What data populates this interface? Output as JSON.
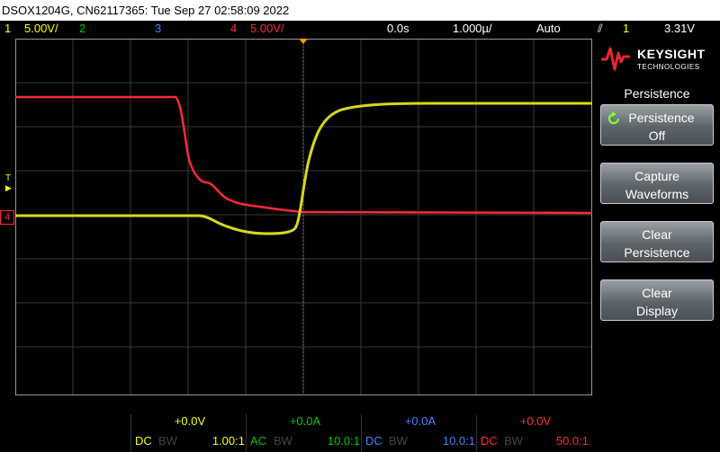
{
  "title_bar": {
    "text": "DSOX1204G, CN62117365: Tue Sep 27 02:58:09 2022"
  },
  "status_bar": {
    "ch1_num": "1",
    "ch1_scale": "5.00V/",
    "ch2_num": "2",
    "ch3_num": "3",
    "ch4_num": "4",
    "ch4_scale": "5.00V/",
    "delay": "0.0s",
    "timebase": "1.000µ/",
    "trigger_mode": "Auto",
    "trigger_source": "1",
    "trigger_level": "3.31V"
  },
  "colors": {
    "ch1": "#ffff00",
    "ch2": "#00cc00",
    "ch3": "#4f7fff",
    "ch4": "#ff2a3a",
    "grid": "#3a3a3a"
  },
  "markers": {
    "trigger_marker": "T",
    "ch4_marker": "4"
  },
  "right_panel": {
    "logo_name": "KEYSIGHT",
    "logo_sub": "TECHNOLOGIES",
    "menu_title": "Persistence",
    "softkeys": [
      {
        "line1": "Persistence",
        "line2": "Off",
        "icon": "rotate-icon"
      },
      {
        "line1": "Capture",
        "line2": "Waveforms"
      },
      {
        "line1": "Clear",
        "line2": "Persistence"
      },
      {
        "line1": "Clear",
        "line2": "Display"
      }
    ]
  },
  "channels": [
    {
      "offset": "+0.0V",
      "coupling": "DC",
      "bw": "BW",
      "ratio": "1.00:1"
    },
    {
      "offset": "+0.0A",
      "coupling": "AC",
      "bw": "BW",
      "ratio": "10.0:1"
    },
    {
      "offset": "+0.0A",
      "coupling": "DC",
      "bw": "BW",
      "ratio": "10.0:1"
    },
    {
      "offset": "+0.0V",
      "coupling": "DC",
      "bw": "BW",
      "ratio": "50.0:1"
    }
  ]
}
